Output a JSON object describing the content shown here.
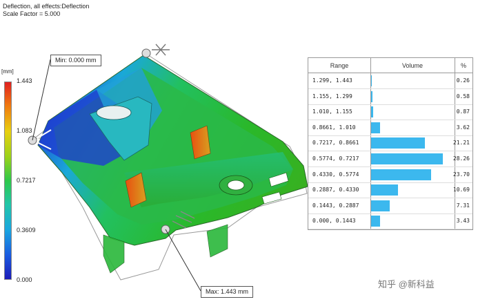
{
  "header": {
    "line1": "Deflection, all effects:Deflection",
    "line2": "Scale Factor = 5.000"
  },
  "callouts": {
    "min_label": "Min: 0.000 mm",
    "max_label": "Max: 1.443 mm"
  },
  "legend": {
    "unit": "[mm]",
    "ticks": [
      "1.443",
      "1.083",
      "0.7217",
      "0.3609",
      "0.000"
    ]
  },
  "histogram": {
    "headers": [
      "Range",
      "Volume",
      "%"
    ],
    "rows": [
      {
        "range": "1.299, 1.443",
        "percent": "0.26",
        "value": 0.26
      },
      {
        "range": "1.155, 1.299",
        "percent": "0.58",
        "value": 0.58
      },
      {
        "range": "1.010, 1.155",
        "percent": "0.87",
        "value": 0.87
      },
      {
        "range": "0.8661, 1.010",
        "percent": "3.62",
        "value": 3.62
      },
      {
        "range": "0.7217, 0.8661",
        "percent": "21.21",
        "value": 21.21
      },
      {
        "range": "0.5774, 0.7217",
        "percent": "28.26",
        "value": 28.26
      },
      {
        "range": "0.4330, 0.5774",
        "percent": "23.70",
        "value": 23.7
      },
      {
        "range": "0.2887, 0.4330",
        "percent": "10.69",
        "value": 10.69
      },
      {
        "range": "0.1443, 0.2887",
        "percent": "7.31",
        "value": 7.31
      },
      {
        "range": "0.000, 0.1443",
        "percent": "3.43",
        "value": 3.43
      }
    ]
  },
  "watermark": "知乎 @新科益",
  "colors": {
    "bar": "#3cb8ee"
  }
}
